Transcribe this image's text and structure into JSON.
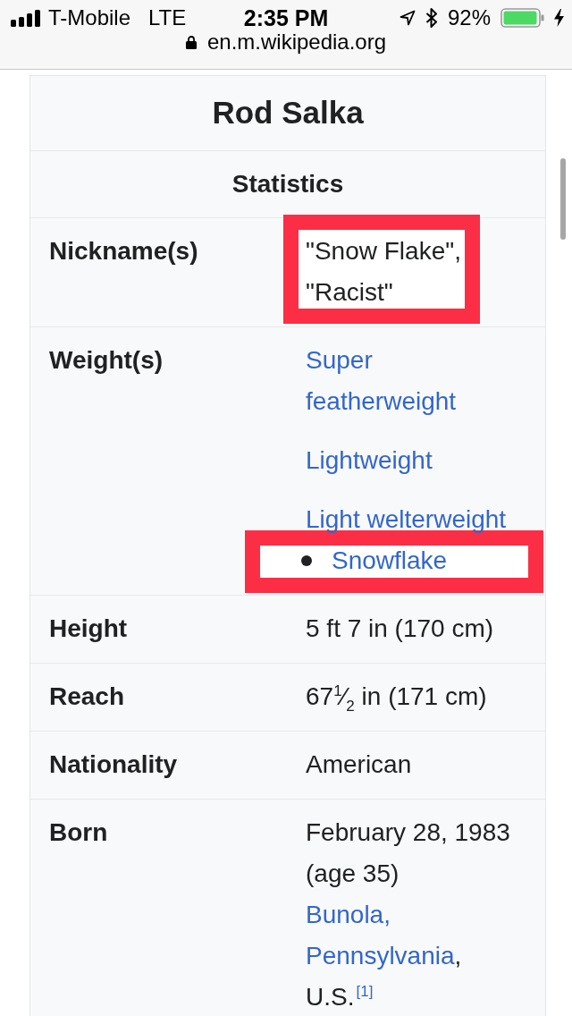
{
  "status_bar": {
    "carrier": "T-Mobile",
    "network": "LTE",
    "time": "2:35 PM",
    "battery": "92%"
  },
  "address_bar": {
    "url": "en.m.wikipedia.org"
  },
  "infobox": {
    "title": "Rod Salka",
    "section": "Statistics",
    "rows": [
      {
        "label": "Nickname(s)",
        "items": [
          {
            "kind": "text",
            "text": "\"Snow Flake\", \"Racist\"",
            "highlighted": true
          }
        ]
      },
      {
        "label": "Weight(s)",
        "items": [
          {
            "kind": "link",
            "text": "Super featherweight",
            "highlighted": false
          },
          {
            "kind": "link",
            "text": "Lightweight",
            "highlighted": false
          },
          {
            "kind": "link",
            "text": "Light welterweight",
            "highlighted": false
          },
          {
            "kind": "bullet_link",
            "text": "Snowflake",
            "highlighted": true
          }
        ]
      },
      {
        "label": "Height",
        "items": [
          {
            "kind": "text",
            "text": "5 ft 7 in (170 cm)",
            "highlighted": false
          }
        ]
      },
      {
        "label": "Reach",
        "items": [
          {
            "kind": "text",
            "text": "67$^{1}$⁄$_{2}$ in (171 cm)",
            "highlighted": false
          }
        ]
      },
      {
        "label": "Nationality",
        "items": [
          {
            "kind": "text",
            "text": "American",
            "highlighted": false
          }
        ]
      },
      {
        "label": "Born",
        "items": [
          {
            "kind": "text",
            "text": "February 28, 1983 (age 35)",
            "highlighted": false
          },
          {
            "kind": "parts",
            "highlighted": false,
            "parts": [
              {
                "kind": "link",
                "text": "Bunola,"
              }
            ]
          },
          {
            "kind": "parts",
            "highlighted": false,
            "parts": [
              {
                "kind": "link",
                "text": "Pennsylvania"
              },
              {
                "kind": "text",
                "text": ","
              }
            ]
          },
          {
            "kind": "parts",
            "highlighted": false,
            "parts": [
              {
                "kind": "text",
                "text": "U.S."
              },
              {
                "kind": "ref",
                "text": "[1]"
              }
            ]
          }
        ]
      }
    ]
  }
}
